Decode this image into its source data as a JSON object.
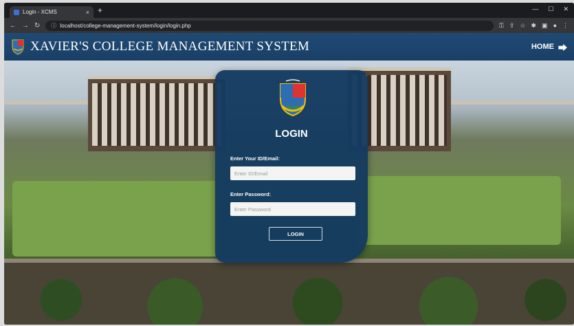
{
  "browser": {
    "tab_title": "Login - XCMS",
    "new_tab": "+",
    "tab_close": "×",
    "url": "localhost/college-management-system/login/login.php"
  },
  "header": {
    "title": "XAVIER'S COLLEGE MANAGEMENT SYSTEM",
    "home_label": "HOME"
  },
  "login": {
    "title": "LOGIN",
    "id_label": "Enter Your ID/Email:",
    "id_placeholder": "Enter ID/Email",
    "password_label": "Enter Password:",
    "password_placeholder": "Enter Password",
    "button_label": "LOGIN"
  },
  "icons": {
    "home": "sign-in-icon",
    "logo": "college-crest-icon"
  },
  "colors": {
    "header_bg": "#1f4a74",
    "card_bg": "#143a60",
    "text": "#ffffff"
  }
}
